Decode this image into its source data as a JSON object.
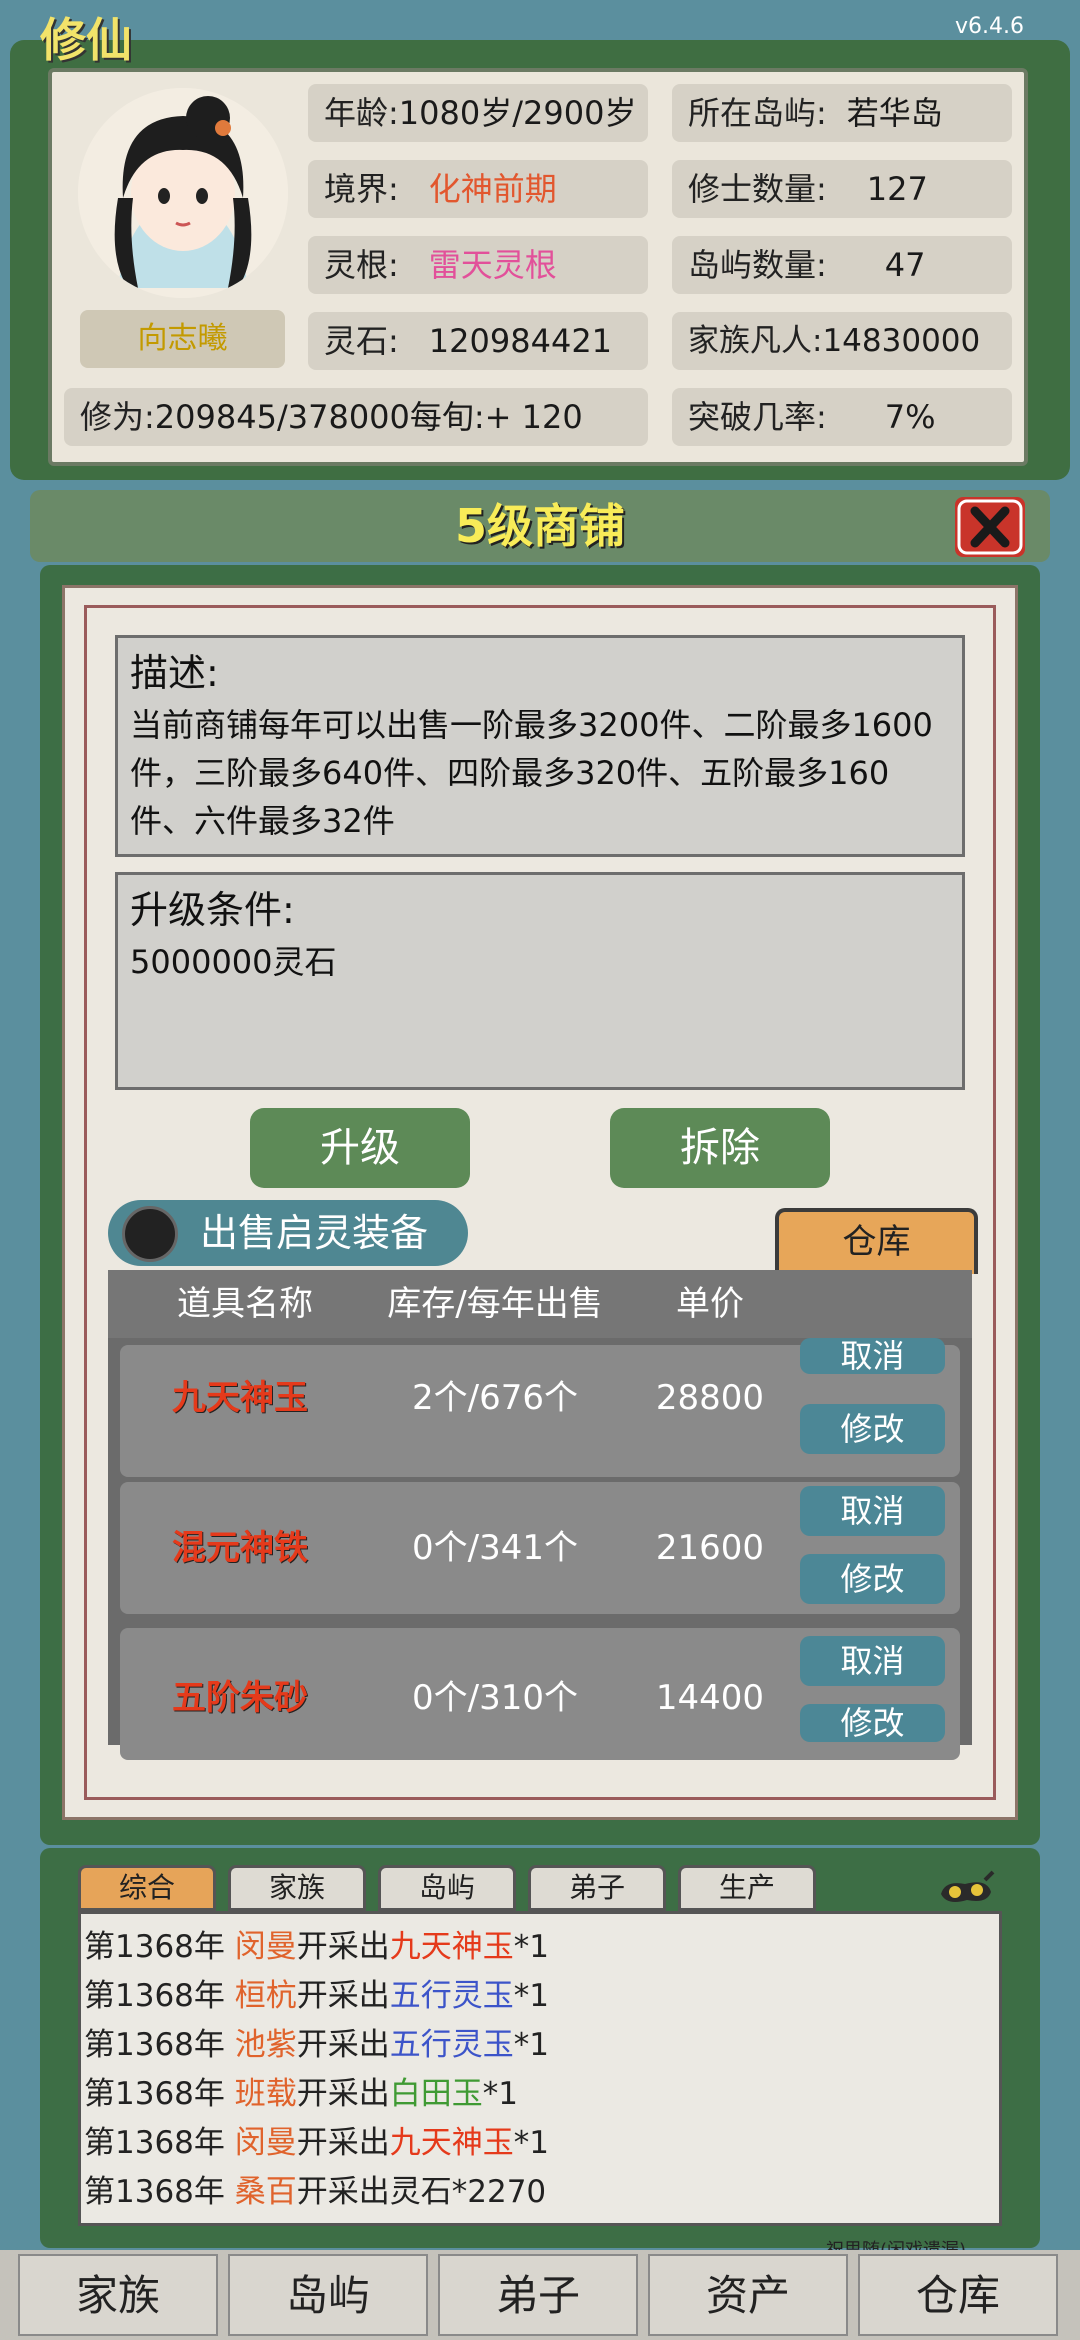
{
  "header": {
    "logo_text": "修仙",
    "version": "v6.4.6"
  },
  "character": {
    "name": "向志曦",
    "age_label": "年龄:",
    "age_value": "1080岁/2900岁",
    "realm_label": "境界:",
    "realm_value": "化神前期",
    "root_label": "灵根:",
    "root_value": "雷天灵根",
    "stone_label": "灵石:",
    "stone_value": "120984421",
    "cultivation_label": "修为:",
    "cultivation_value": "209845/378000每旬:+ 120",
    "island_label": "所在岛屿:",
    "island_value": "若华岛",
    "cultivator_label": "修士数量:",
    "cultivator_value": "127",
    "island_count_label": "岛屿数量:",
    "island_count_value": "47",
    "mortal_label": "家族凡人:",
    "mortal_value": "14830000",
    "breakthrough_label": "突破几率:",
    "breakthrough_value": "7%"
  },
  "shop": {
    "title": "5级商铺",
    "description_title": "描述:",
    "description_text": "当前商铺每年可以出售一阶最多3200件、二阶最多1600件，三阶最多640件、四阶最多320件、五阶最多160件、六件最多32件",
    "upgrade_title": "升级条件:",
    "upgrade_text": "5000000灵石",
    "upgrade_button": "升级",
    "demolish_button": "拆除",
    "sell_toggle_label": "出售启灵装备",
    "warehouse_tab": "仓库",
    "columns": [
      "道具名称",
      "库存/每年出售",
      "单价"
    ],
    "rows": [
      {
        "name": "九天神玉",
        "stock": "2个/676个",
        "price": "28800",
        "cancel": "取消",
        "edit": "修改"
      },
      {
        "name": "混元神铁",
        "stock": "0个/341个",
        "price": "21600",
        "cancel": "取消",
        "edit": "修改"
      },
      {
        "name": "五阶朱砂",
        "stock": "0个/310个",
        "price": "14400",
        "cancel": "取消",
        "edit": "修改"
      }
    ]
  },
  "log": {
    "tabs": [
      "综合",
      "家族",
      "岛屿",
      "弟子",
      "生产"
    ],
    "lines": [
      {
        "year": "第1368年",
        "person": "闵曼",
        "verb": "开采出",
        "item": "九天神玉",
        "count": "*1",
        "item_color": "red"
      },
      {
        "year": "第1368年",
        "person": "桓杭",
        "verb": "开采出",
        "item": "五行灵玉",
        "count": "*1",
        "item_color": "blue"
      },
      {
        "year": "第1368年",
        "person": "池紫",
        "verb": "开采出",
        "item": "五行灵玉",
        "count": "*1",
        "item_color": "blue"
      },
      {
        "year": "第1368年",
        "person": "班载",
        "verb": "开采出",
        "item": "白田玉",
        "count": "*1",
        "item_color": "green"
      },
      {
        "year": "第1368年",
        "person": "闵曼",
        "verb": "开采出",
        "item": "九天神玉",
        "count": "*1",
        "item_color": "red"
      },
      {
        "year": "第1368年",
        "person": "桑百",
        "verb": "开采出",
        "item": "灵石",
        "count": "*2270",
        "item_color": "plain"
      }
    ],
    "footer_note": "祝思随(闲戏遗漏)"
  },
  "nav": {
    "items": [
      "家族",
      "岛屿",
      "弟子",
      "资产",
      "仓库"
    ]
  },
  "colors": {
    "frame_green": "#3d6e45",
    "title_yellow": "#f8ec58",
    "button_green": "#5d8a57",
    "button_teal": "#4c8796",
    "tab_orange": "#e6a459",
    "item_red": "#e53a1b"
  }
}
